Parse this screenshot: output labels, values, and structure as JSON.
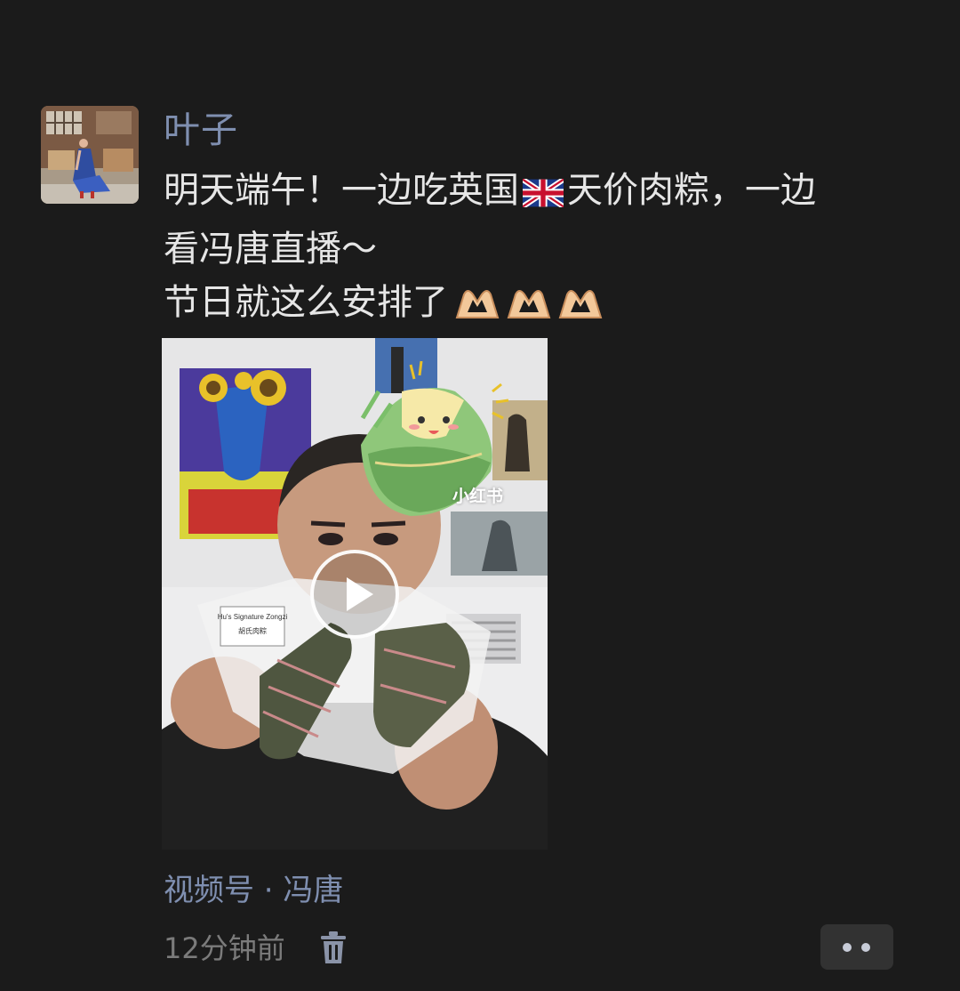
{
  "post": {
    "username": "叶子",
    "text_lines": [
      {
        "before_flag": "明天端午！一边吃英国",
        "after_flag": "天价肉粽，一边"
      },
      "看冯唐直播～",
      "节日就这么安排了"
    ],
    "video": {
      "watermark": "小红书",
      "package_label_en": "Hu's Signature Zongzi",
      "package_label_cn": "胡氏肉粽"
    },
    "channel": "视频号 · 冯唐",
    "time": "12分钟前"
  },
  "icons": {
    "flag": "uk-flag-emoji",
    "hearts": "heart-hands-emoji",
    "delete": "trash-icon",
    "more": "more-dots-icon",
    "play": "play-icon"
  },
  "colors": {
    "background": "#1b1b1b",
    "username": "#7f8fb0",
    "text": "#e6e6e6",
    "meta": "#7b7b7b"
  }
}
